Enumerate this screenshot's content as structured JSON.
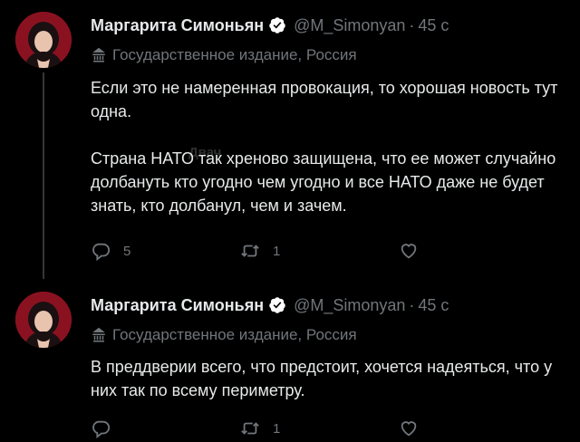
{
  "theme": {
    "background": "#000000",
    "text": "#e7e9ea",
    "muted": "#71767b",
    "verified": "#ffffff",
    "avatar_bg": "#8a1220"
  },
  "watermark": "Двач",
  "tweets": [
    {
      "author_name": "Маргарита Симоньян",
      "handle": "@M_Simonyan",
      "separator": "·",
      "time": "45 с",
      "label": "Государственное издание, Россия",
      "label_icon": "state-media-icon",
      "text": [
        "Если это не намеренная провокация, то хорошая новость тут одна.",
        "Страна НАТО так хреново защищена, что ее может случайно долбануть кто угодно чем угодно и все НАТО даже не будет знать, кто долбанул, чем и зачем."
      ],
      "replies": "5",
      "retweets": "1",
      "likes": ""
    },
    {
      "author_name": "Маргарита Симоньян",
      "handle": "@M_Simonyan",
      "separator": "·",
      "time": "45 с",
      "label": "Государственное издание, Россия",
      "label_icon": "state-media-icon",
      "text": [
        "В преддверии всего, что предстоит, хочется надеяться, что у них так по всему периметру."
      ],
      "replies": "",
      "retweets": "1",
      "likes": ""
    }
  ]
}
